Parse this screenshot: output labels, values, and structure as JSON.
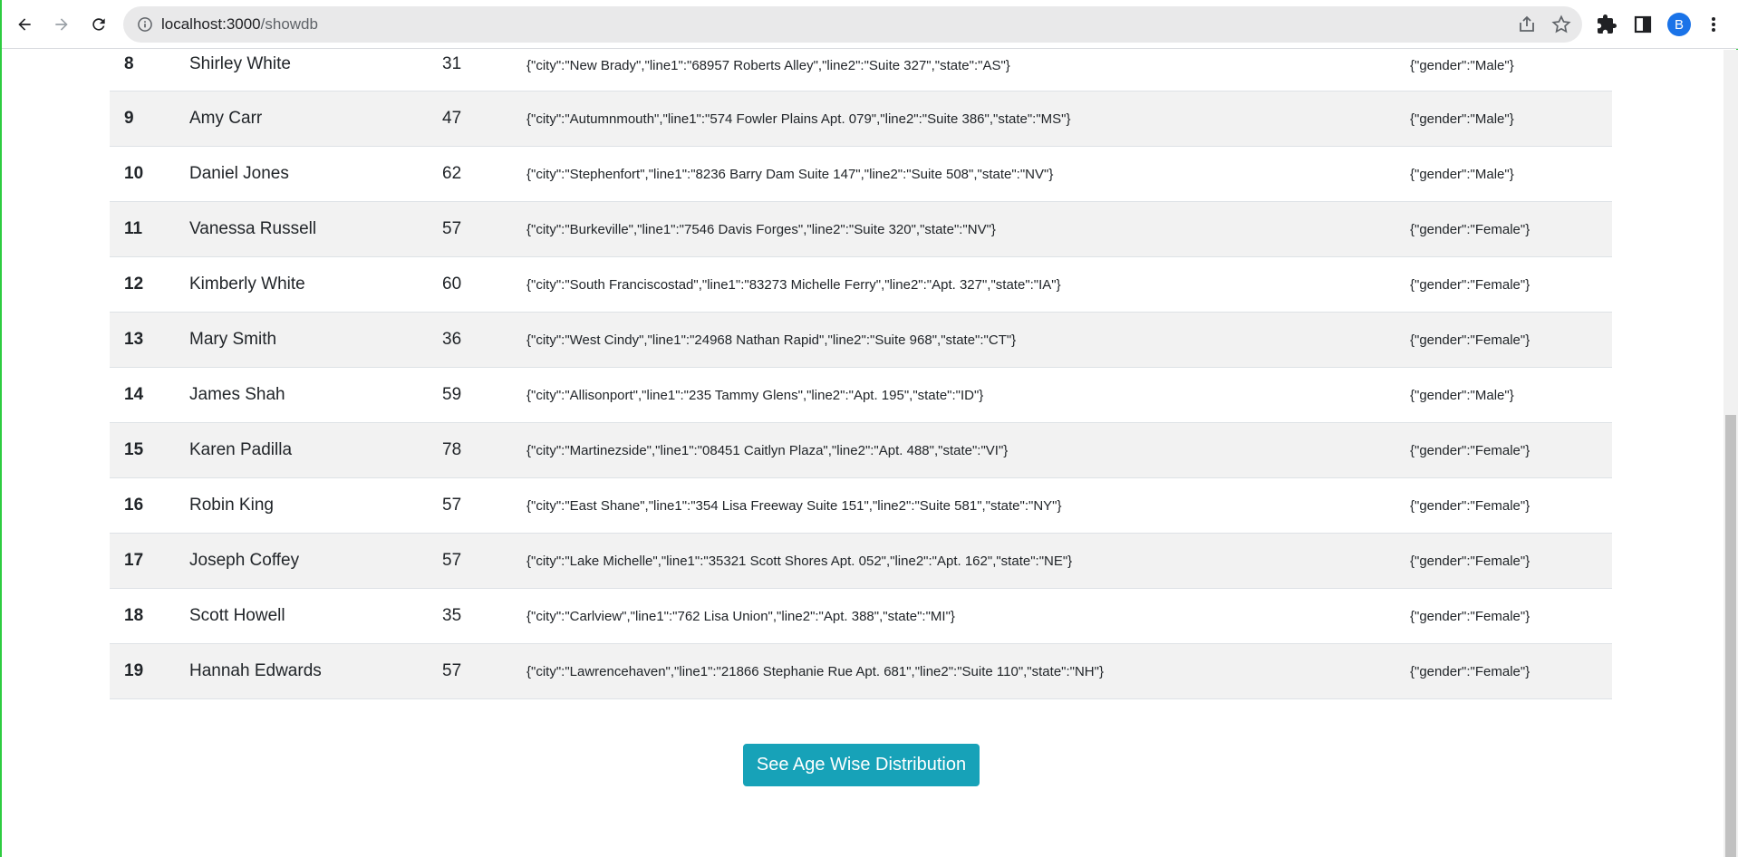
{
  "browser": {
    "url_host": "localhost:3000",
    "url_path": "/showdb",
    "avatar_letter": "B",
    "icons": [
      "back-icon",
      "forward-icon",
      "reload-icon",
      "info-icon",
      "share-icon",
      "bookmark-star-icon",
      "extensions-icon",
      "side-panel-icon",
      "menu-icon"
    ]
  },
  "table": {
    "rows": [
      {
        "id": "8",
        "name": "Shirley White",
        "age": "31",
        "address": "{\"city\":\"New Brady\",\"line1\":\"68957 Roberts Alley\",\"line2\":\"Suite 327\",\"state\":\"AS\"}",
        "meta": "{\"gender\":\"Male\"}"
      },
      {
        "id": "9",
        "name": "Amy Carr",
        "age": "47",
        "address": "{\"city\":\"Autumnmouth\",\"line1\":\"574 Fowler Plains Apt. 079\",\"line2\":\"Suite 386\",\"state\":\"MS\"}",
        "meta": "{\"gender\":\"Male\"}"
      },
      {
        "id": "10",
        "name": "Daniel Jones",
        "age": "62",
        "address": "{\"city\":\"Stephenfort\",\"line1\":\"8236 Barry Dam Suite 147\",\"line2\":\"Suite 508\",\"state\":\"NV\"}",
        "meta": "{\"gender\":\"Male\"}"
      },
      {
        "id": "11",
        "name": "Vanessa Russell",
        "age": "57",
        "address": "{\"city\":\"Burkeville\",\"line1\":\"7546 Davis Forges\",\"line2\":\"Suite 320\",\"state\":\"NV\"}",
        "meta": "{\"gender\":\"Female\"}"
      },
      {
        "id": "12",
        "name": "Kimberly White",
        "age": "60",
        "address": "{\"city\":\"South Franciscostad\",\"line1\":\"83273 Michelle Ferry\",\"line2\":\"Apt. 327\",\"state\":\"IA\"}",
        "meta": "{\"gender\":\"Female\"}"
      },
      {
        "id": "13",
        "name": "Mary Smith",
        "age": "36",
        "address": "{\"city\":\"West Cindy\",\"line1\":\"24968 Nathan Rapid\",\"line2\":\"Suite 968\",\"state\":\"CT\"}",
        "meta": "{\"gender\":\"Female\"}"
      },
      {
        "id": "14",
        "name": "James Shah",
        "age": "59",
        "address": "{\"city\":\"Allisonport\",\"line1\":\"235 Tammy Glens\",\"line2\":\"Apt. 195\",\"state\":\"ID\"}",
        "meta": "{\"gender\":\"Male\"}"
      },
      {
        "id": "15",
        "name": "Karen Padilla",
        "age": "78",
        "address": "{\"city\":\"Martinezside\",\"line1\":\"08451 Caitlyn Plaza\",\"line2\":\"Apt. 488\",\"state\":\"VI\"}",
        "meta": "{\"gender\":\"Female\"}"
      },
      {
        "id": "16",
        "name": "Robin King",
        "age": "57",
        "address": "{\"city\":\"East Shane\",\"line1\":\"354 Lisa Freeway Suite 151\",\"line2\":\"Suite 581\",\"state\":\"NY\"}",
        "meta": "{\"gender\":\"Female\"}"
      },
      {
        "id": "17",
        "name": "Joseph Coffey",
        "age": "57",
        "address": "{\"city\":\"Lake Michelle\",\"line1\":\"35321 Scott Shores Apt. 052\",\"line2\":\"Apt. 162\",\"state\":\"NE\"}",
        "meta": "{\"gender\":\"Female\"}"
      },
      {
        "id": "18",
        "name": "Scott Howell",
        "age": "35",
        "address": "{\"city\":\"Carlview\",\"line1\":\"762 Lisa Union\",\"line2\":\"Apt. 388\",\"state\":\"MI\"}",
        "meta": "{\"gender\":\"Female\"}"
      },
      {
        "id": "19",
        "name": "Hannah Edwards",
        "age": "57",
        "address": "{\"city\":\"Lawrencehaven\",\"line1\":\"21866 Stephanie Rue Apt. 681\",\"line2\":\"Suite 110\",\"state\":\"NH\"}",
        "meta": "{\"gender\":\"Female\"}"
      }
    ]
  },
  "actions": {
    "distribution_label": "See Age Wise Distribution",
    "button_color": "#17a2b8"
  }
}
